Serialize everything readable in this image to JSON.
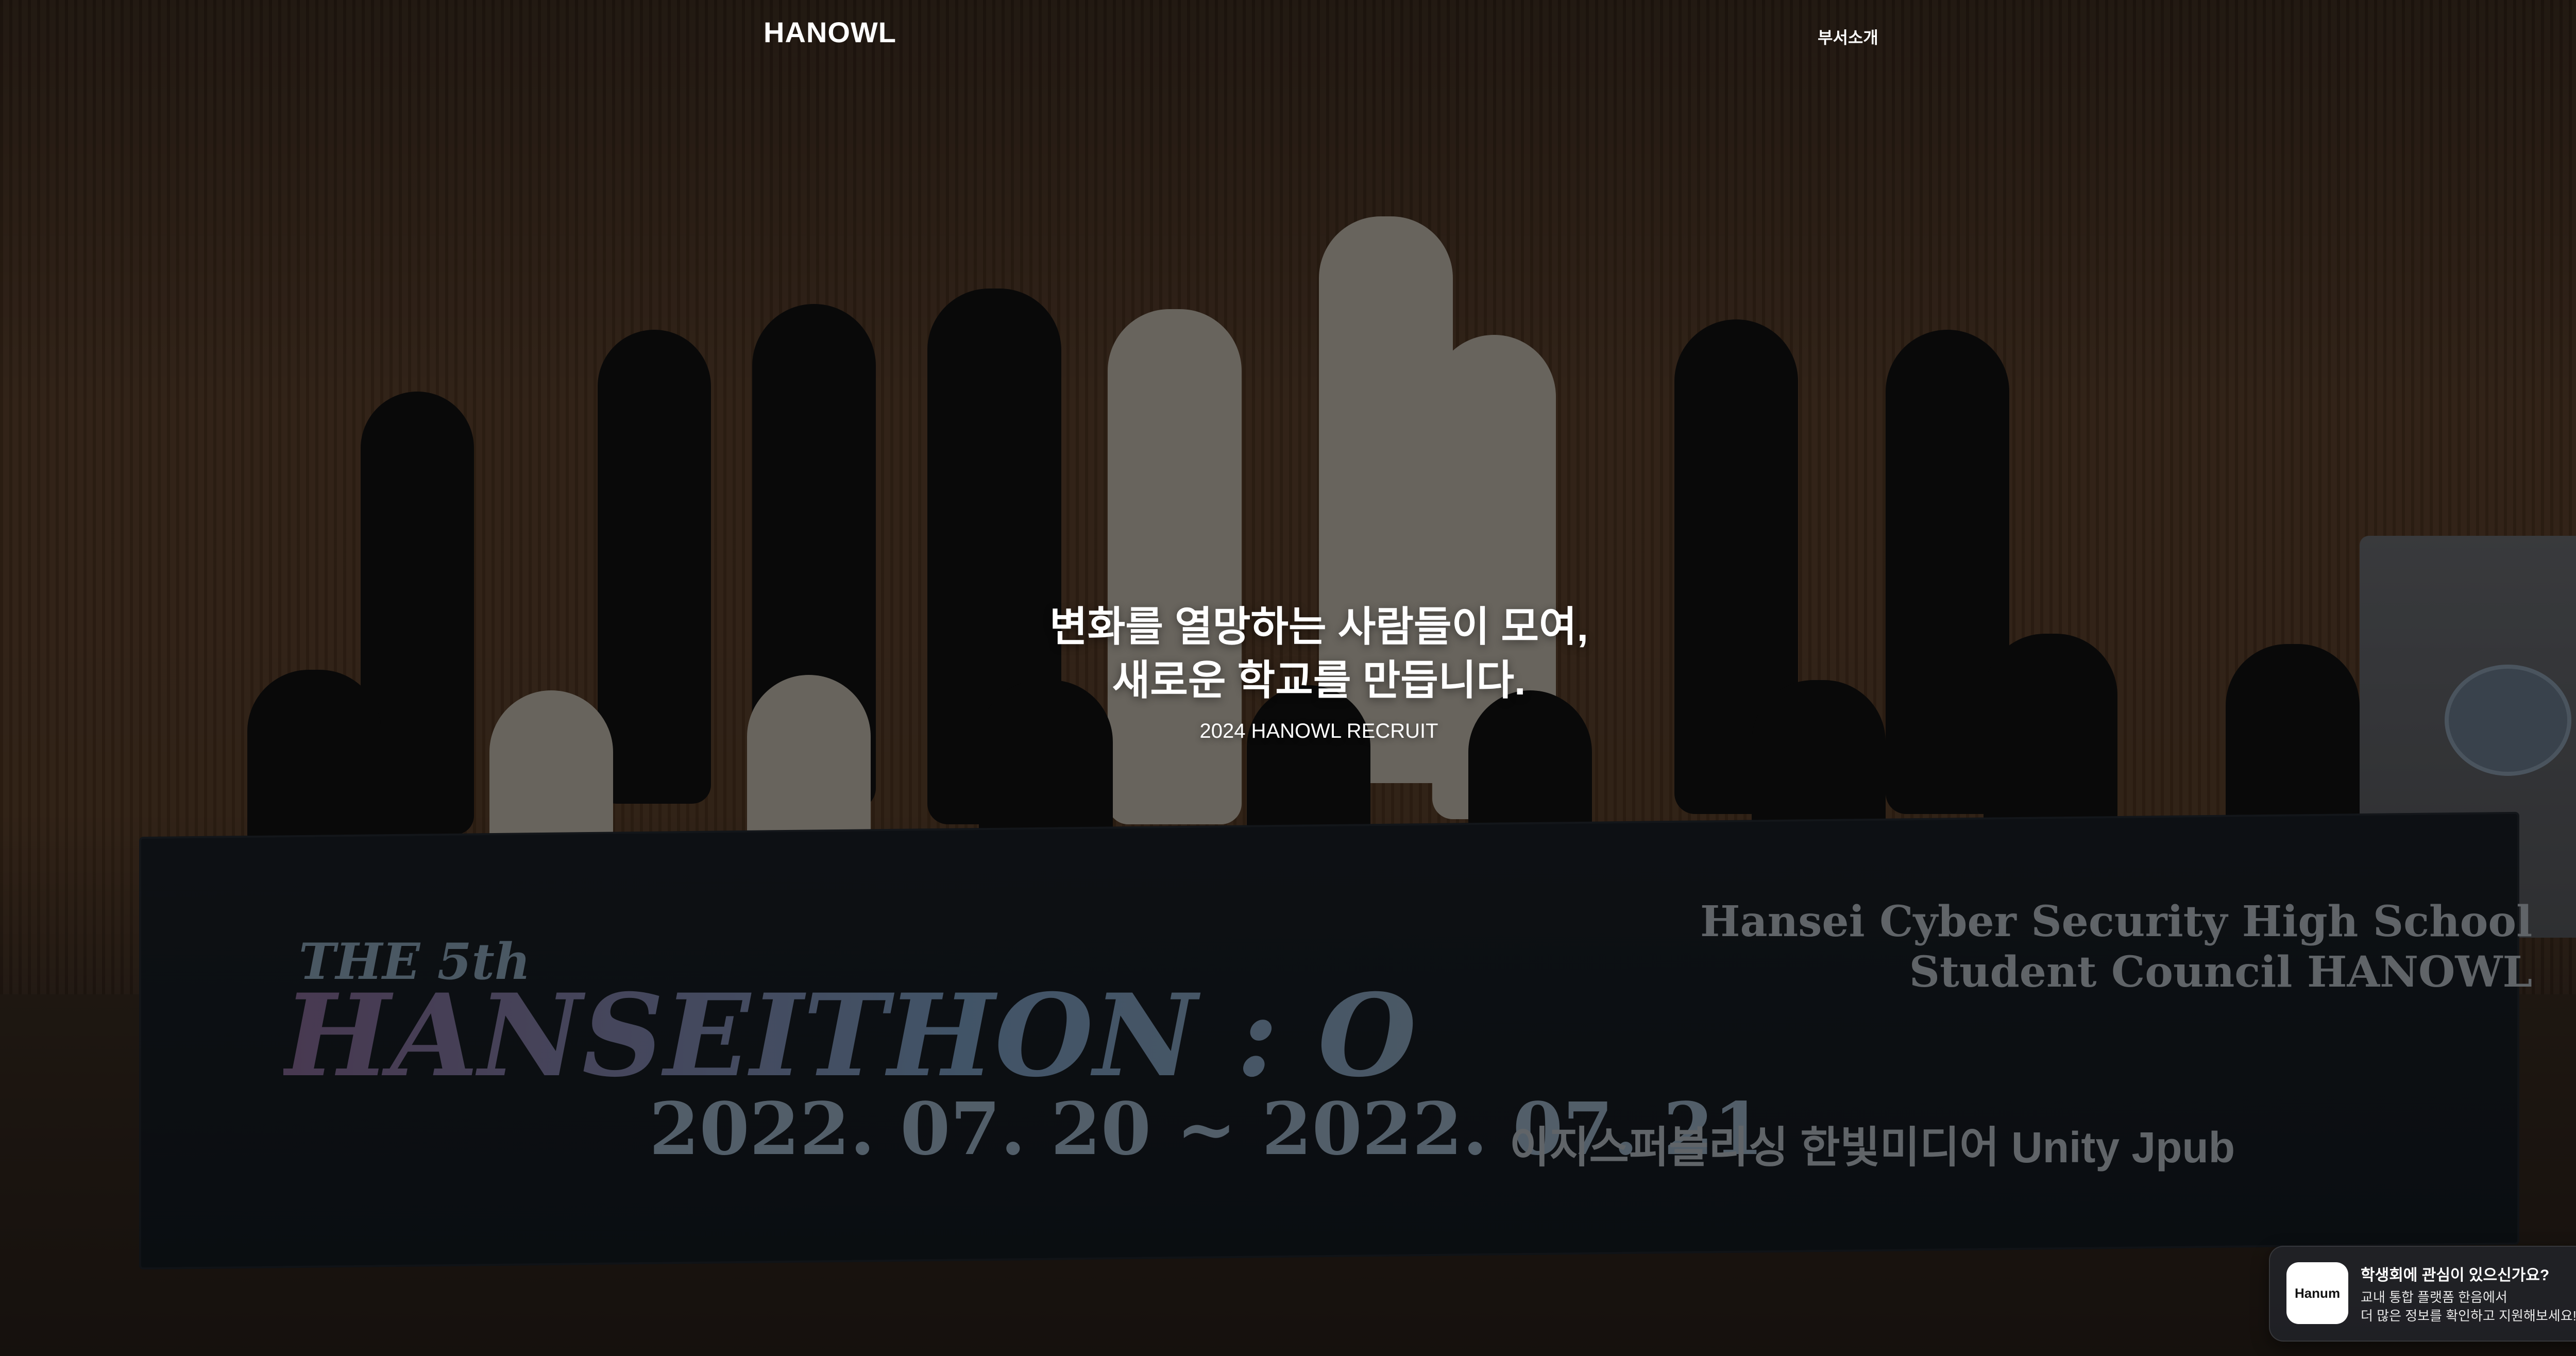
{
  "nav": {
    "logo": "HANOWL",
    "links": [
      {
        "label": "부서소개"
      }
    ]
  },
  "hero": {
    "heading_line1": "변화를 열망하는 사람들이 모여,",
    "heading_line2": "새로운 학교를 만듭니다.",
    "subtitle": "2024 HANOWL RECRUIT",
    "banner": {
      "title_small": "THE 5th",
      "title_big": "HANSEITHON : O",
      "date": "2022. 07. 20 ~ 2022. 07. 21",
      "school_line1": "Hansei Cyber Security High School",
      "school_line2": "Student Council HANOWL",
      "sponsors": "이지스퍼블리싱   한빛미디어   Unity   Jpub"
    }
  },
  "promo": {
    "icon_label": "Hanum",
    "title": "학생회에 관심이 있으신가요?",
    "line1": "교내 통합 플랫폼 한음에서",
    "line2": "더 많은 정보를 확인하고 지원해보세요!"
  },
  "colors": {
    "overlay": "rgba(0,0,0,0.48)",
    "text": "#ffffff",
    "popup_bg": "#22252b"
  }
}
